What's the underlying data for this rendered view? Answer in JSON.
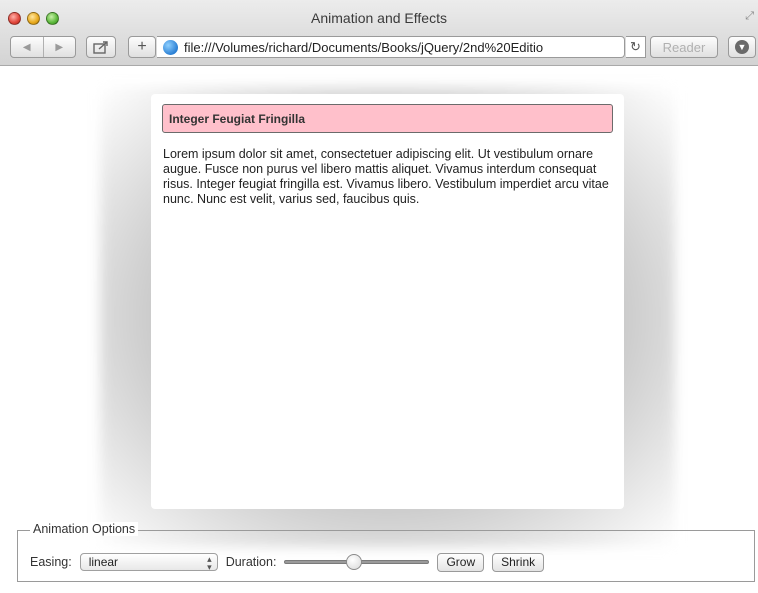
{
  "window": {
    "title": "Animation and Effects",
    "url": "file:///Volumes/richard/Documents/Books/jQuery/2nd%20Editio",
    "reader_label": "Reader"
  },
  "icons": {
    "back": "back-arrow-icon",
    "forward": "forward-arrow-icon",
    "share": "share-icon",
    "add": "add-tab-icon",
    "globe": "globe-icon",
    "reload": "reload-icon",
    "download": "download-icon",
    "fullscreen": "fullscreen-icon"
  },
  "panel": {
    "heading": "Integer Feugiat Fringilla",
    "body": "Lorem ipsum dolor sit amet, consectetuer adipiscing elit. Ut vestibulum ornare augue. Fusce non purus vel libero mattis aliquet. Vivamus interdum consequat risus. Integer feugiat fringilla est. Vivamus libero. Vestibulum imperdiet arcu vitae nunc. Nunc est velit, varius sed, faucibus quis.",
    "heading_color": "#ffc0cb"
  },
  "options": {
    "legend": "Animation Options",
    "easing_label": "Easing:",
    "easing_value": "linear",
    "duration_label": "Duration:",
    "duration_fraction": 0.48,
    "grow_label": "Grow",
    "shrink_label": "Shrink"
  }
}
